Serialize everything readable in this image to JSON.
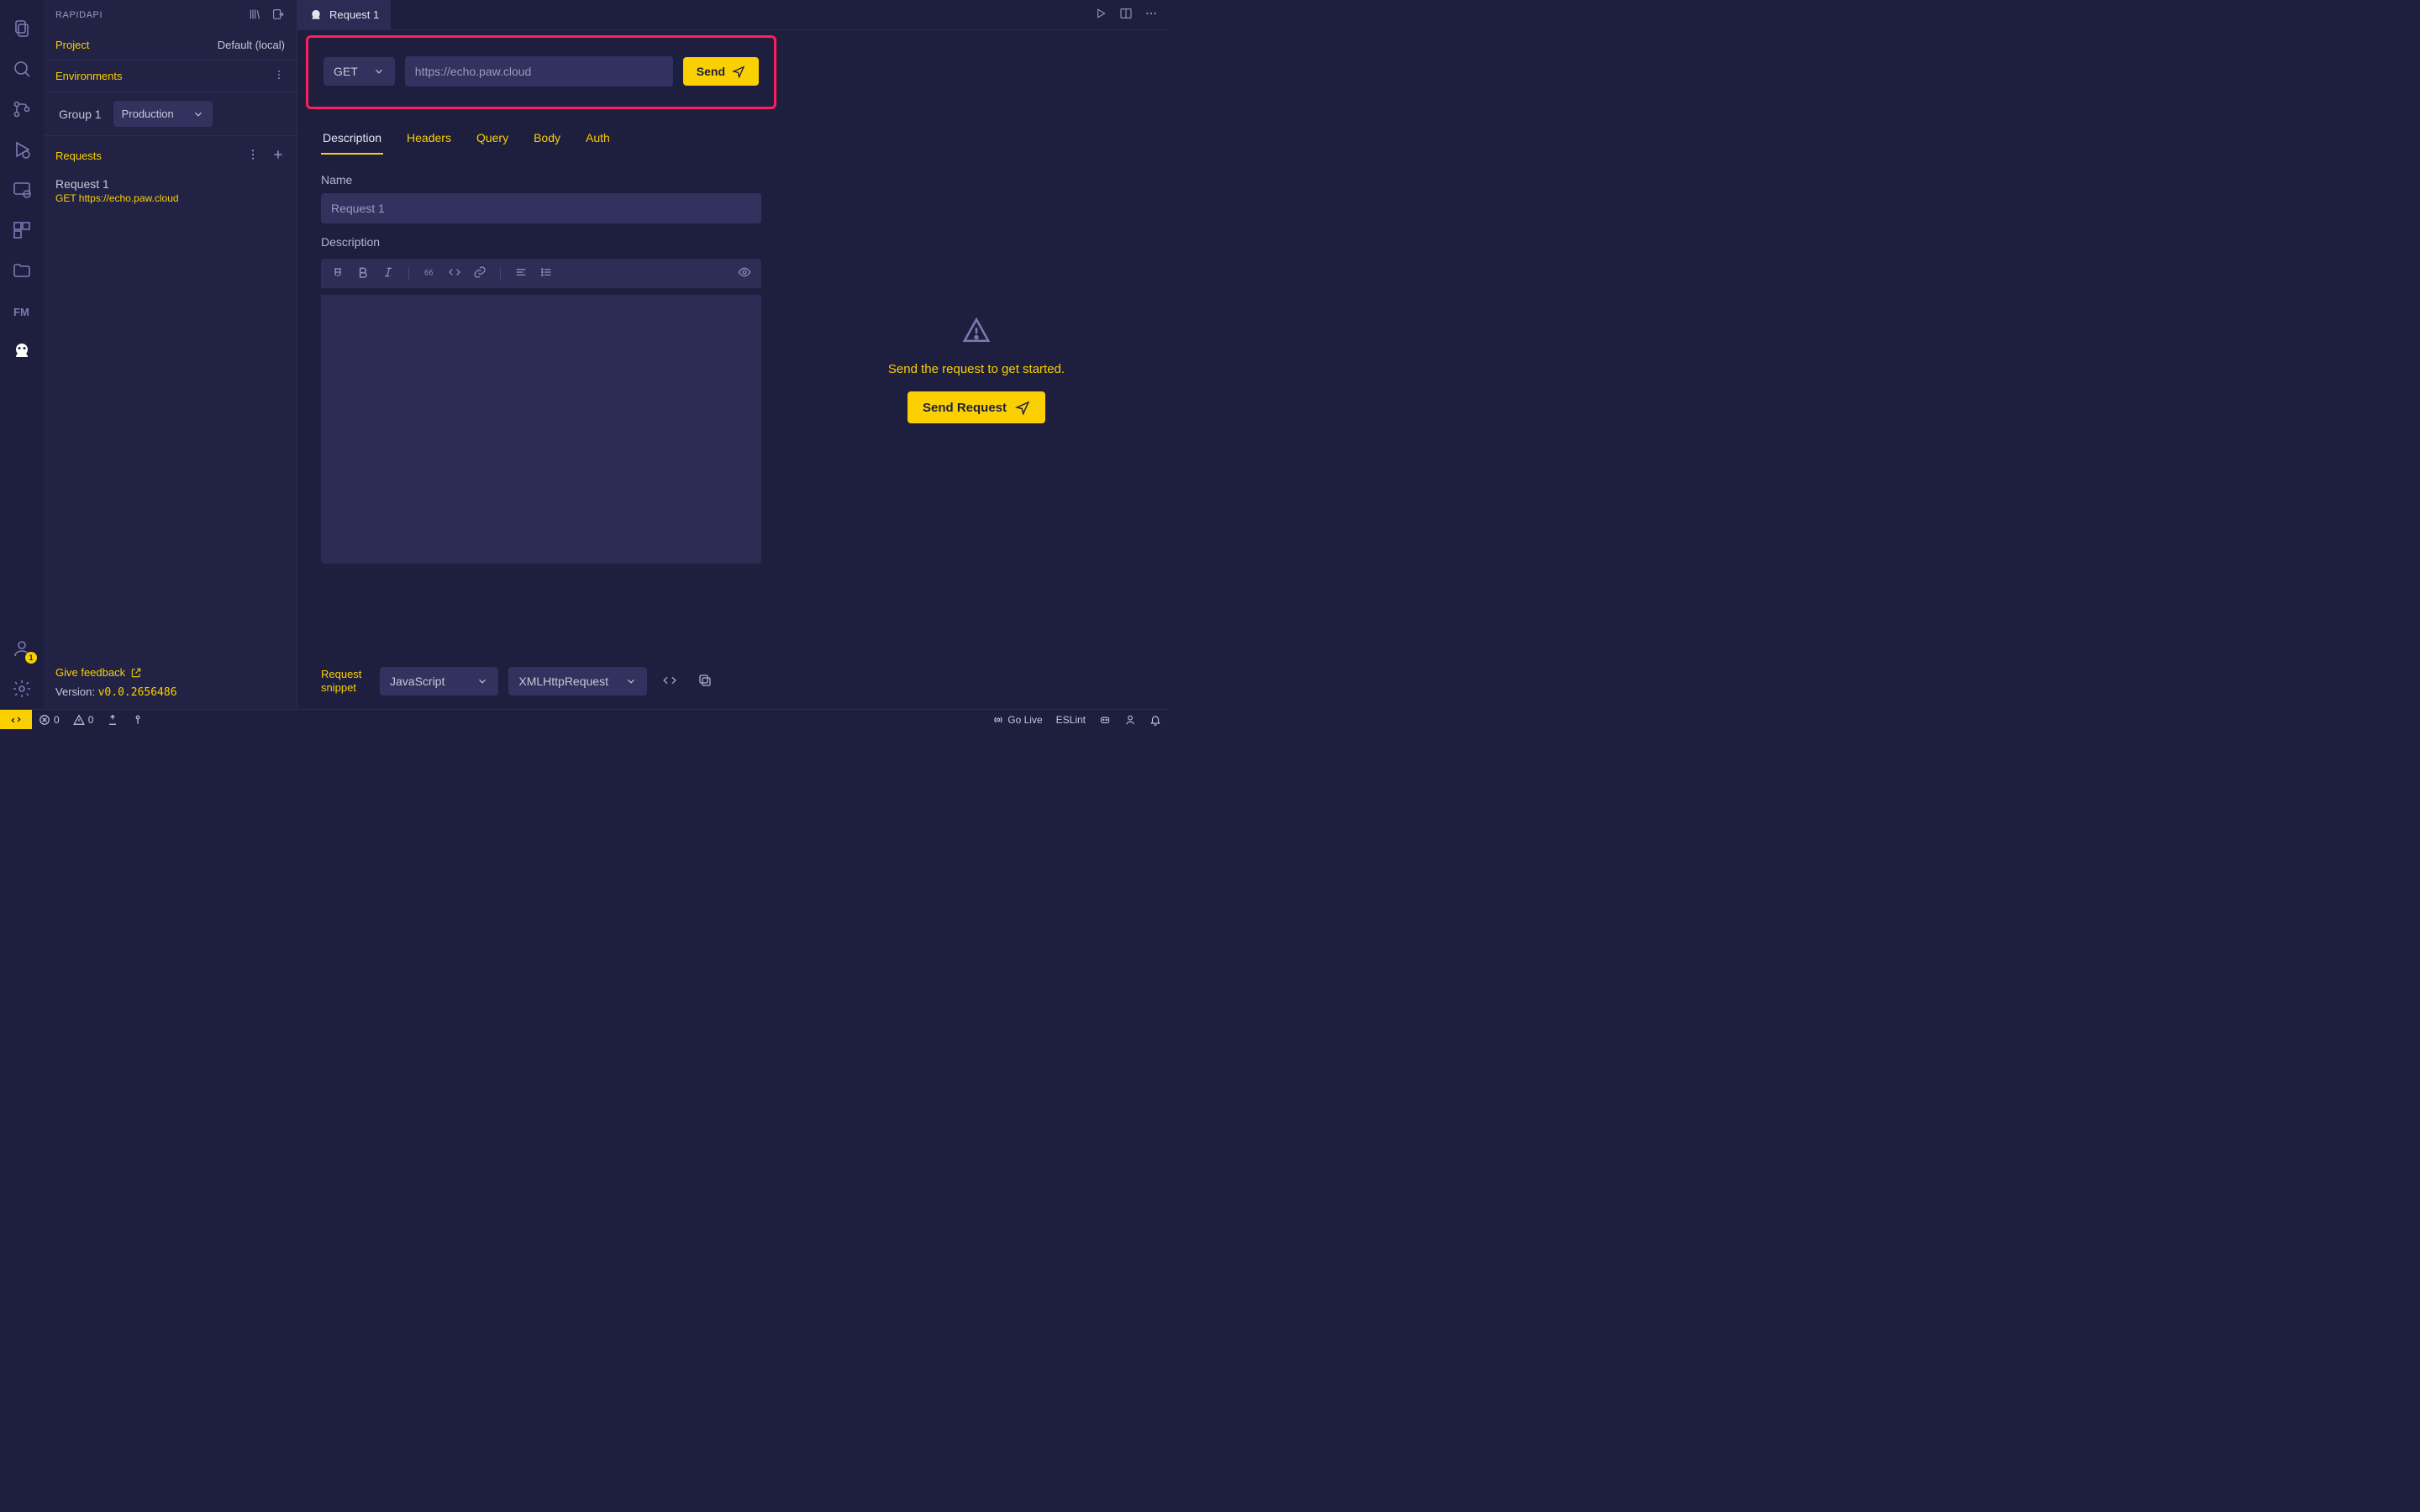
{
  "sidebar": {
    "title": "RAPIDAPI",
    "project_label": "Project",
    "project_value": "Default (local)",
    "environments_label": "Environments",
    "group_label": "Group 1",
    "env_selected": "Production",
    "requests_label": "Requests",
    "items": [
      {
        "title": "Request 1",
        "method": "GET",
        "url": "https://echo.paw.cloud"
      }
    ],
    "feedback_label": "Give feedback",
    "version_prefix": "Version:",
    "version": "v0.0.2656486"
  },
  "activity": {
    "accounts_badge": "1"
  },
  "tabbar": {
    "tabs": [
      {
        "label": "Request 1"
      }
    ]
  },
  "request": {
    "method": "GET",
    "url": "https://echo.paw.cloud",
    "send_label": "Send",
    "tabs": [
      "Description",
      "Headers",
      "Query",
      "Body",
      "Auth"
    ],
    "active_tab": "Description",
    "name_label": "Name",
    "name_value": "Request 1",
    "description_label": "Description",
    "snippet_label": "Request snippet",
    "snippet_lang": "JavaScript",
    "snippet_target": "XMLHttpRequest"
  },
  "response": {
    "hint": "Send the request to get started.",
    "send_label": "Send Request"
  },
  "statusbar": {
    "errors": "0",
    "warnings": "0",
    "go_live": "Go Live",
    "eslint": "ESLint"
  }
}
